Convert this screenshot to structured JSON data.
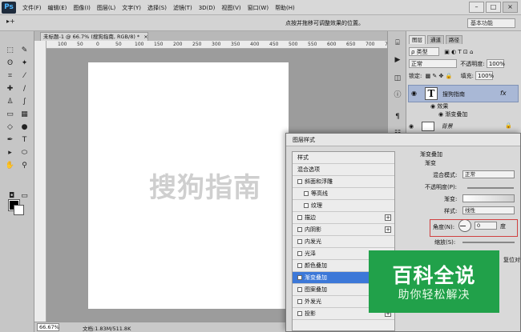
{
  "app": {
    "logo": "Ps"
  },
  "menu": [
    "文件(F)",
    "编辑(E)",
    "图像(I)",
    "图层(L)",
    "文字(Y)",
    "选择(S)",
    "滤镜(T)",
    "3D(D)",
    "视图(V)",
    "窗口(W)",
    "帮助(H)"
  ],
  "window_buttons": {
    "minimize": "–",
    "maximize": "□",
    "close": "×"
  },
  "options": {
    "tool": "▸+",
    "hint": "点按并拖移可调整效果的位置。",
    "workspace": "基本功能"
  },
  "document": {
    "tab_label": "未标题-1 @ 66.7% (搜狗指南, RGB/8) *",
    "close": "×",
    "ruler_numbers": [
      "100",
      "50",
      "0",
      "50",
      "100",
      "150",
      "200",
      "250",
      "300",
      "350",
      "400",
      "450",
      "500",
      "550",
      "600",
      "650",
      "700",
      "750"
    ],
    "canvas_text": "搜狗指南",
    "zoom": "66.67%",
    "doc_info": "文档:1.83M/511.8K"
  },
  "layers_panel": {
    "tabs": [
      "图层",
      "通道",
      "路径"
    ],
    "filter_kind": "ρ 类型",
    "blend_mode": "正常",
    "opacity_label": "不透明度:",
    "opacity_value": "100%",
    "lock_label": "锁定:",
    "fill_label": "填充:",
    "fill_value": "100%",
    "layers": [
      {
        "name": "搜狗指南",
        "type": "T",
        "fx": "fx"
      },
      {
        "name": "效果"
      },
      {
        "name": "渐变叠加"
      },
      {
        "name": "背景"
      }
    ]
  },
  "layer_style": {
    "title": "图层样式",
    "items": [
      {
        "label": "样式",
        "checkbox": false,
        "plus": false
      },
      {
        "label": "混合选项",
        "checkbox": false,
        "plus": false
      },
      {
        "label": "斜面和浮雕",
        "checkbox": true,
        "plus": false
      },
      {
        "label": "等高线",
        "checkbox": true,
        "plus": false
      },
      {
        "label": "纹理",
        "checkbox": true,
        "plus": false
      },
      {
        "label": "描边",
        "checkbox": true,
        "plus": true
      },
      {
        "label": "内阴影",
        "checkbox": true,
        "plus": true
      },
      {
        "label": "内发光",
        "checkbox": true,
        "plus": false
      },
      {
        "label": "光泽",
        "checkbox": true,
        "plus": false
      },
      {
        "label": "颜色叠加",
        "checkbox": true,
        "plus": true
      },
      {
        "label": "渐变叠加",
        "checkbox": true,
        "plus": true,
        "selected": true
      },
      {
        "label": "图案叠加",
        "checkbox": true,
        "plus": false
      },
      {
        "label": "外发光",
        "checkbox": true,
        "plus": false
      },
      {
        "label": "投影",
        "checkbox": true,
        "plus": true
      }
    ],
    "section_title": "渐变叠加",
    "group_title": "渐变",
    "blend_label": "混合模式:",
    "blend_value": "正常",
    "opacity_label": "不透明度(P):",
    "gradient_label": "渐变:",
    "style_label": "样式:",
    "style_value": "线性",
    "angle_label": "角度(N):",
    "angle_value": "0",
    "angle_unit": "度",
    "scale_label": "缩放(S):",
    "reset_label": "复位对齐"
  },
  "logo": {
    "title": "百科全说",
    "subtitle": "助你轻松解决"
  }
}
